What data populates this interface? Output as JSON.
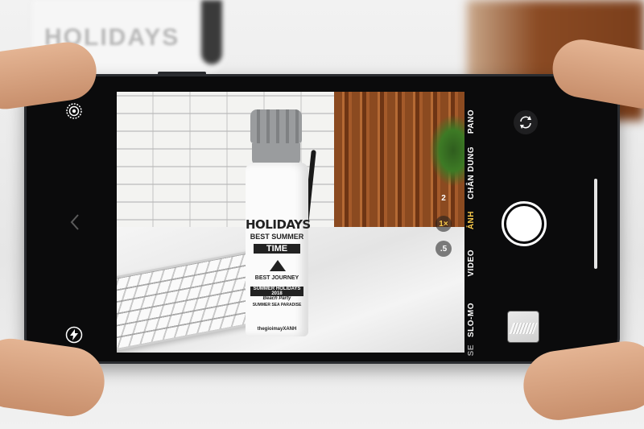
{
  "scene": {
    "background_mug_text": "HOLIDAYS",
    "bottle_print": {
      "line1": "HOLIDAYS",
      "line2": "BEST SUMMER",
      "line3": "TIME",
      "line4": "BEST JOURNEY",
      "line5": "SUMMER HOLIDAYS 2018",
      "line6": "Beach Party",
      "line7": "SUMMER SEA PARADISE",
      "brand": "thegioimayXANH"
    }
  },
  "camera": {
    "zoom_options": [
      "2",
      "1×",
      ".5"
    ],
    "selected_zoom": "1×",
    "modes": [
      "SE",
      "SLO-MO",
      "VIDEO",
      "ẢNH",
      "CHÂN DUNG",
      "PANO"
    ],
    "active_mode": "ẢNH"
  },
  "colors": {
    "accent": "#f5c74a",
    "phone_body": "#0b0b0c"
  },
  "icons": {
    "live": "live-photo-icon",
    "flash": "flash-icon",
    "chevron": "chevron-left-icon",
    "flip": "camera-flip-icon"
  }
}
